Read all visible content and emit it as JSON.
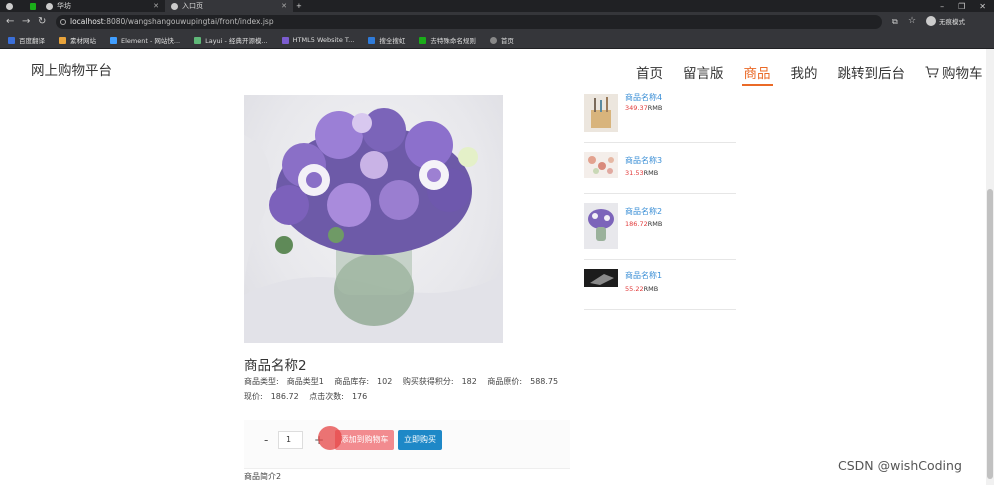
{
  "browser": {
    "tabs": [
      {
        "label": "",
        "active": false
      },
      {
        "label": "",
        "active": false
      },
      {
        "label": "华坊",
        "active": false
      },
      {
        "label": "入口页",
        "active": true
      }
    ],
    "new_tab": "+",
    "url_host": "localhost",
    "url_rest": ":8080/wangshangouwupingtai/front/index.jsp",
    "account_label": "无痕模式",
    "bookmarks": [
      {
        "label": "百度翻译",
        "color": "#3b6fd9"
      },
      {
        "label": "素材网站",
        "color": "#e8a33a"
      },
      {
        "label": "Element - 网站快...",
        "color": "#409eff"
      },
      {
        "label": "Layui - 经典开源模...",
        "color": "#5fb878"
      },
      {
        "label": "HTML5 Website T...",
        "color": "#7b5ccf"
      },
      {
        "label": "搜全搜虹",
        "color": "#2f7bd9"
      },
      {
        "label": "去特殊命名规则",
        "color": "#1aad19"
      },
      {
        "label": "首页",
        "color": "#888888"
      }
    ]
  },
  "site": {
    "logo": "网上购物平台",
    "nav": [
      {
        "label": "首页",
        "active": false
      },
      {
        "label": "留言版",
        "active": false
      },
      {
        "label": "商品",
        "active": true
      },
      {
        "label": "我的",
        "active": false
      },
      {
        "label": "跳转到后台",
        "active": false
      }
    ],
    "cart_label": "购物车",
    "accent_color": "#ea6a27"
  },
  "product": {
    "name": "商品名称2",
    "type_label": "商品类型:",
    "type_value": "商品类型1",
    "stock_label": "商品库存:",
    "stock_value": "102",
    "points_label": "购买获得积分:",
    "points_value": "182",
    "orig_price_label": "商品原价:",
    "orig_price_value": "588.75",
    "price_label": "现价:",
    "price_value": "186.72",
    "clicks_label": "点击次数:",
    "clicks_value": "176",
    "qty_minus": "-",
    "qty_value": "1",
    "qty_plus": "+",
    "add_cart_label": "添加到购物车",
    "buy_now_label": "立即购买",
    "intro_label": "商品简介2"
  },
  "related": [
    {
      "name": "商品名称4",
      "price": "349.37",
      "currency": "RMB"
    },
    {
      "name": "商品名称3",
      "price": "31.53",
      "currency": "RMB"
    },
    {
      "name": "商品名称2",
      "price": "186.72",
      "currency": "RMB"
    },
    {
      "name": "商品名称1",
      "price": "55.22",
      "currency": "RMB"
    }
  ],
  "watermark": "CSDN @wishCoding"
}
